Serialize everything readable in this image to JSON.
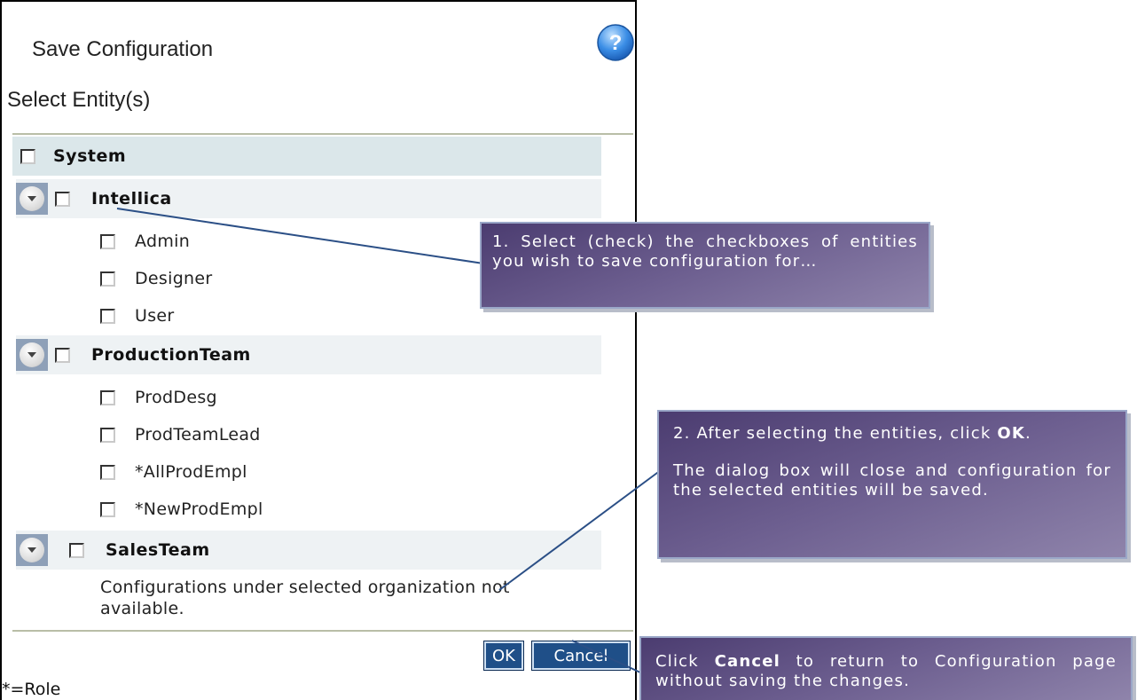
{
  "dialog": {
    "title": "Save Configuration",
    "subtitle": "Select Entity(s)",
    "help_icon": "question-mark-icon"
  },
  "tree": {
    "root_label": "System",
    "orgs": [
      {
        "label": "Intellica",
        "items": [
          "Admin",
          "Designer",
          "User"
        ]
      },
      {
        "label": "ProductionTeam",
        "items": [
          "ProdDesg",
          "ProdTeamLead",
          "*AllProdEmpl",
          "*NewProdEmpl"
        ]
      },
      {
        "label": "SalesTeam",
        "items": []
      }
    ],
    "unavailable_note": "Configurations under selected organization not available."
  },
  "buttons": {
    "ok": "OK",
    "cancel": "Cancel"
  },
  "legend": "*=Role",
  "callouts": {
    "c1": "1. Select (check) the checkboxes of entities you wish to save configuration for…",
    "c2_pre": "2. After selecting the entities, click ",
    "c2_bold": "OK",
    "c2_post": ".",
    "c2_p2": "The dialog box will close and configuration for the selected entities will be saved.",
    "c3_pre": "Click ",
    "c3_bold": "Cancel",
    "c3_post": " to return to Configuration page without saving the changes."
  },
  "colors": {
    "header_row": "#dbe7ea",
    "org_row": "#eef2f4",
    "button": "#1f4f88",
    "callout_start": "#4b3c70",
    "callout_end": "#8f84ab"
  }
}
